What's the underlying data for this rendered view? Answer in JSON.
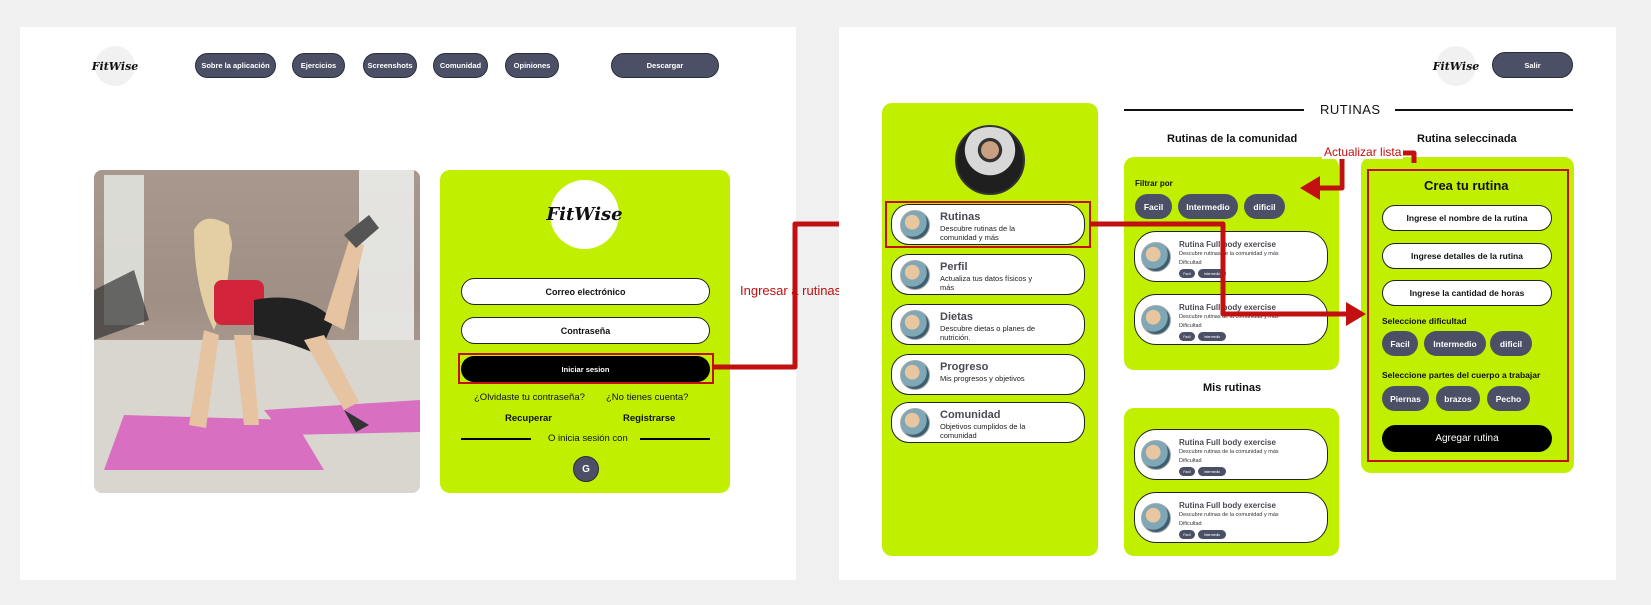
{
  "left_screen": {
    "brand": "FitWise",
    "nav": [
      "Sobre la aplicación",
      "Ejercicios",
      "Screenshots",
      "Comunidad",
      "Opiniones"
    ],
    "download_button": "Descargar",
    "login": {
      "logo": "FitWise",
      "email_placeholder": "Correo electrónico",
      "password_placeholder": "Contraseña",
      "submit_button": "Iniciar sesion",
      "forgot_question": "¿Olvidaste tu contraseña?",
      "no_account_question": "¿No tienes cuenta?",
      "recover_link": "Recuperar",
      "register_link": "Registrarse",
      "divider_text": "O inicia sesión con",
      "google_button": "G"
    }
  },
  "annotations": {
    "to_routines": "Ingresar a rutinas",
    "update_list": "Actualizar lista"
  },
  "right_screen": {
    "brand": "FitWise",
    "logout_button": "Salir",
    "section_title": "RUTINAS",
    "menu": [
      {
        "title": "Rutinas",
        "desc": "Descubre rutinas de la comunidad y más"
      },
      {
        "title": "Perfil",
        "desc": "Actualiza tus datos físicos y más"
      },
      {
        "title": "Dietas",
        "desc": "Descubre dietas o planes de nutrición."
      },
      {
        "title": "Progreso",
        "desc": "Mis progresos y objetivos"
      },
      {
        "title": "Comunidad",
        "desc": "Objetivos cumplidos de la comunidad"
      }
    ],
    "community": {
      "heading": "Rutinas de la comunidad",
      "filter_label": "Filtrar por",
      "filters": [
        "Facil",
        "Intermedio",
        "dificil"
      ],
      "cards": [
        {
          "title": "Rutina Full body exercise",
          "desc": "Descubre rutinas de la comunidad y más",
          "difficulty": "Dificultad",
          "tags": [
            "Facil",
            "Intermedio"
          ]
        },
        {
          "title": "Rutina Full body exercise",
          "desc": "Descubre rutinas de la comunidad y más",
          "difficulty": "Dificultad",
          "tags": [
            "Facil",
            "Intermedio"
          ]
        }
      ]
    },
    "mine": {
      "heading": "Mis rutinas",
      "cards": [
        {
          "title": "Rutina Full body exercise",
          "desc": "Descubre rutinas de la comunidad y más",
          "difficulty": "Dificultad",
          "tags": [
            "Facil",
            "Intermedio"
          ]
        },
        {
          "title": "Rutina Full body exercise",
          "desc": "Descubre rutinas de la comunidad y más",
          "difficulty": "Dificultad",
          "tags": [
            "Facil",
            "Intermedio"
          ]
        }
      ]
    },
    "create": {
      "heading": "Rutina seleccinada",
      "title": "Crea tu rutina",
      "name_placeholder": "Ingrese el nombre de la rutina",
      "details_placeholder": "Ingrese detalles de la rutina",
      "hours_placeholder": "Ingrese la cantidad de horas",
      "difficulty_label": "Seleccione dificultad",
      "difficulties": [
        "Facil",
        "Intermedio",
        "dificil"
      ],
      "body_label": "Seleccione partes del cuerpo a trabajar",
      "body_parts": [
        "Piernas",
        "brazos",
        "Pecho"
      ],
      "add_button": "Agregar rutina"
    }
  },
  "colors": {
    "lime": "#c1ef00",
    "pill": "#4c5066",
    "annotation_red": "#c20f0f"
  }
}
